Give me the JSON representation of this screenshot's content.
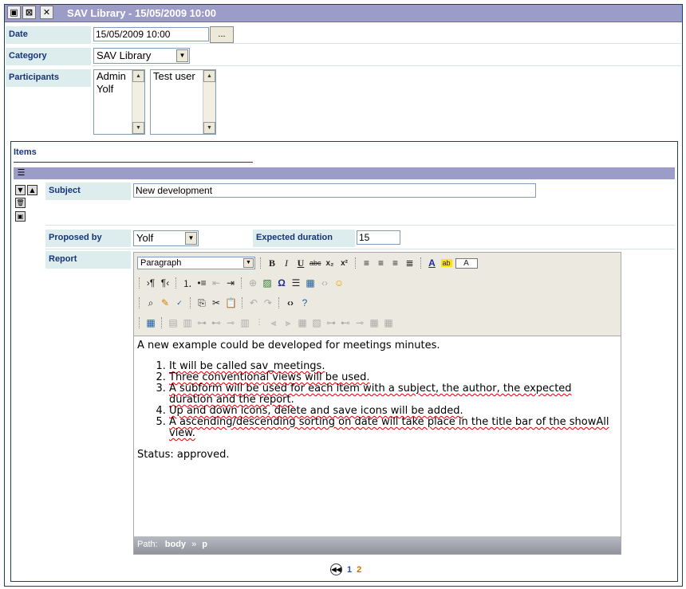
{
  "window": {
    "title": "SAV Library - 15/05/2009 10:00"
  },
  "form": {
    "date": {
      "label": "Date",
      "value": "15/05/2009 10:00",
      "picker_label": "..."
    },
    "category": {
      "label": "Category",
      "value": "SAV Library"
    },
    "participants": {
      "label": "Participants",
      "selected": [
        "Admin",
        "Yolf"
      ],
      "available": [
        "Test user"
      ]
    }
  },
  "items": {
    "title": "Items",
    "subject": {
      "label": "Subject",
      "value": "New development"
    },
    "proposed_by": {
      "label": "Proposed by",
      "value": "Yolf"
    },
    "expected_duration": {
      "label": "Expected duration",
      "value": "15"
    },
    "report": {
      "label": "Report",
      "format": "Paragraph",
      "color_box_label": "A",
      "path_label": "Path:",
      "path_body": "body",
      "path_sep": "»",
      "path_p": "p",
      "content": {
        "intro": "A new example could be developed for meetings minutes.",
        "list": [
          "It will be called sav_meetings.",
          "Three conventional views will be used.",
          "A subform will be used for each item with a subject, the author, the expected duration and the report.",
          "Up and down icons, delete and save icons will be added.",
          "A ascending/descending sorting on date will take place in the title bar of the showAll view."
        ],
        "status": "Status: approved."
      }
    }
  },
  "pager": {
    "page1": "1",
    "page2": "2",
    "current": "2"
  },
  "colors": {
    "titlebar": "#9c9cc9",
    "label_bg": "#ddecec",
    "label_text": "#17347a",
    "border": "#1b3b80"
  }
}
